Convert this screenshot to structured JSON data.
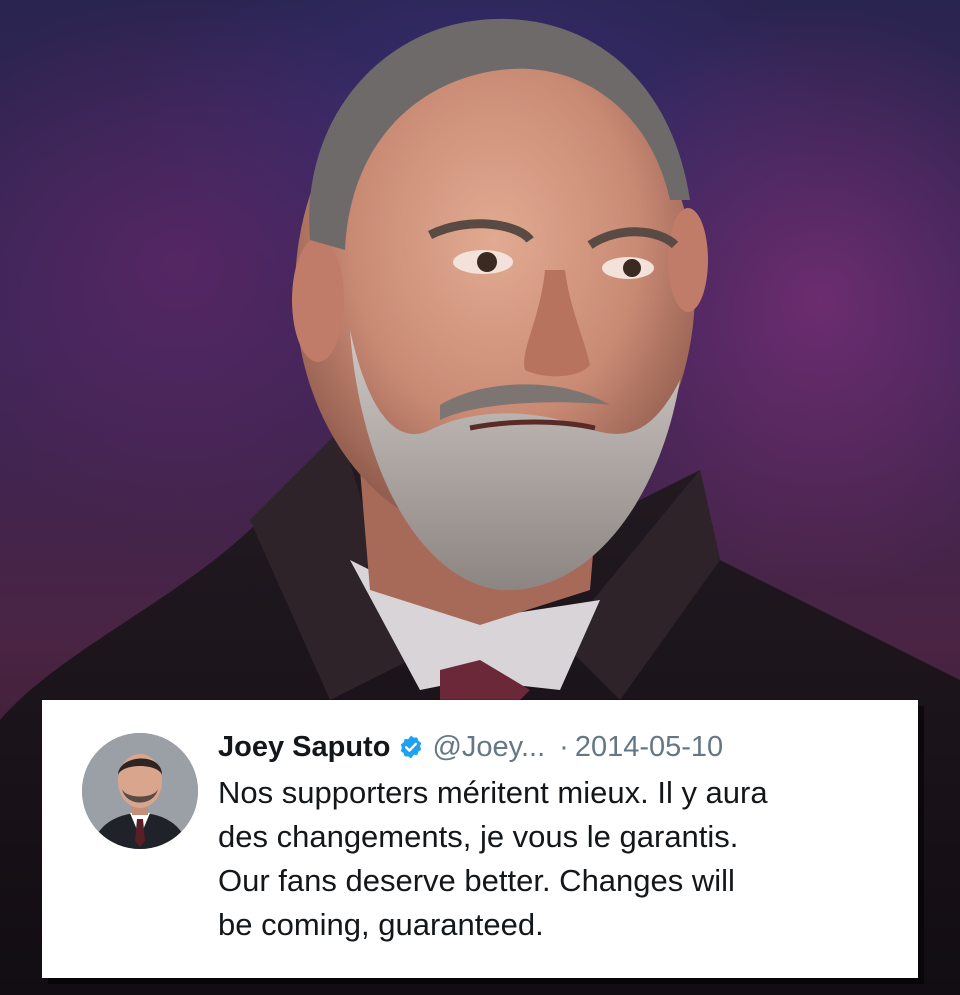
{
  "tweet": {
    "display_name": "Joey Saputo",
    "handle": "@Joey...",
    "separator": "·",
    "date": "2014-05-10",
    "verified_icon": "verified-badge-icon",
    "avatar_icon": "profile-avatar",
    "text_lines": [
      "Nos supporters méritent mieux. Il y aura",
      "des changements, je vous le garantis.",
      "Our fans deserve better. Changes will",
      "be coming, guaranteed."
    ]
  },
  "colors": {
    "verified_blue": "#1da1f2",
    "name_text": "#14171a",
    "secondary_text": "#657786",
    "card_bg": "#ffffff"
  }
}
